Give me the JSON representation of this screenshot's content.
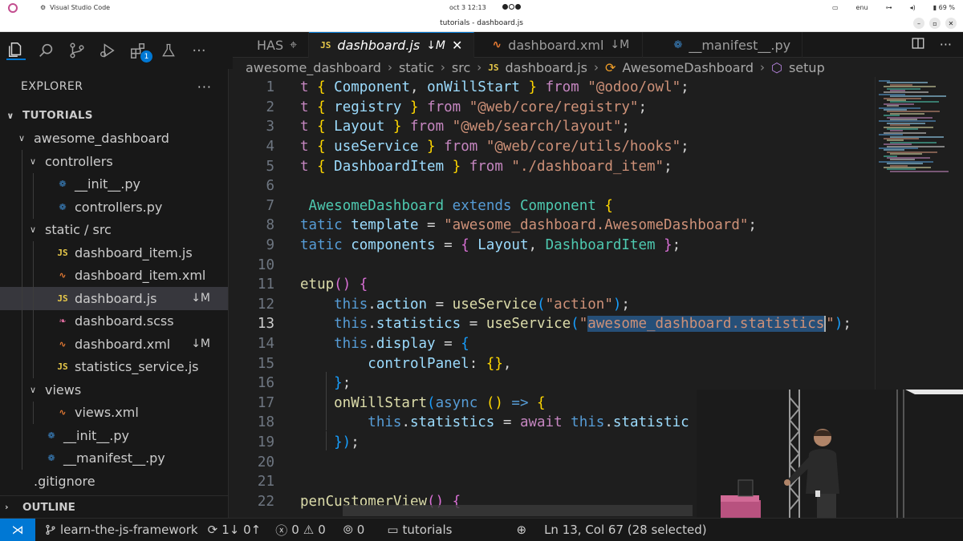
{
  "os_bar": {
    "app_name": "Visual Studio Code",
    "clock": "oct 3  12:13",
    "language": "enu",
    "battery": "69 %"
  },
  "window": {
    "title": "tutorials - dashboard.js"
  },
  "activity_bar": {
    "extensions_badge": "1"
  },
  "sidebar": {
    "header": "EXPLORER",
    "more": "···",
    "root": "TUTORIALS",
    "tree": [
      {
        "label": "awesome_dashboard",
        "type": "folder",
        "depth": 1,
        "expanded": true
      },
      {
        "label": "controllers",
        "type": "folder",
        "depth": 2,
        "expanded": true
      },
      {
        "label": "__init__.py",
        "type": "py",
        "depth": 3
      },
      {
        "label": "controllers.py",
        "type": "py",
        "depth": 3
      },
      {
        "label": "static / src",
        "type": "folder",
        "depth": 2,
        "expanded": true
      },
      {
        "label": "dashboard_item.js",
        "type": "js",
        "depth": 3
      },
      {
        "label": "dashboard_item.xml",
        "type": "xml",
        "depth": 3
      },
      {
        "label": "dashboard.js",
        "type": "js",
        "depth": 3,
        "selected": true,
        "badge": "↓M"
      },
      {
        "label": "dashboard.scss",
        "type": "scss",
        "depth": 3
      },
      {
        "label": "dashboard.xml",
        "type": "xml",
        "depth": 3,
        "badge": "↓M"
      },
      {
        "label": "statistics_service.js",
        "type": "js",
        "depth": 3
      },
      {
        "label": "views",
        "type": "folder",
        "depth": 2,
        "expanded": true
      },
      {
        "label": "views.xml",
        "type": "xml",
        "depth": 3
      },
      {
        "label": "__init__.py",
        "type": "py",
        "depth": 2
      },
      {
        "label": "__manifest__.py",
        "type": "py",
        "depth": 2
      },
      {
        "label": ".gitignore",
        "type": "git",
        "depth": 1
      }
    ],
    "outline": "OUTLINE"
  },
  "tabs": [
    {
      "label": "HAS",
      "icon": "pin-icon",
      "active": false
    },
    {
      "label": "dashboard.js",
      "badge": "↓M",
      "type": "js",
      "active": true
    },
    {
      "label": "dashboard.xml",
      "badge": "↓M",
      "type": "xml",
      "active": false
    },
    {
      "label": "__manifest__.py",
      "type": "py",
      "active": false
    }
  ],
  "breadcrumb": [
    "awesome_dashboard",
    "static",
    "src",
    "dashboard.js",
    "AwesomeDashboard",
    "setup"
  ],
  "editor": {
    "current_line": 13,
    "lines": [
      {
        "n": "1",
        "tokens": [
          [
            "t ",
            "k-kw2"
          ],
          [
            "{ ",
            "k-br1"
          ],
          [
            "Component",
            "k-id"
          ],
          [
            ", ",
            "k-p"
          ],
          [
            "onWillStart",
            "k-id"
          ],
          [
            " } ",
            "k-br1"
          ],
          [
            "from ",
            "k-kw2"
          ],
          [
            "\"@odoo/owl\"",
            "k-str"
          ],
          [
            ";",
            "k-p"
          ]
        ]
      },
      {
        "n": "2",
        "tokens": [
          [
            "t ",
            "k-kw2"
          ],
          [
            "{ ",
            "k-br1"
          ],
          [
            "registry",
            "k-id"
          ],
          [
            " } ",
            "k-br1"
          ],
          [
            "from ",
            "k-kw2"
          ],
          [
            "\"@web/core/registry\"",
            "k-str"
          ],
          [
            ";",
            "k-p"
          ]
        ]
      },
      {
        "n": "3",
        "tokens": [
          [
            "t ",
            "k-kw2"
          ],
          [
            "{ ",
            "k-br1"
          ],
          [
            "Layout",
            "k-id"
          ],
          [
            " } ",
            "k-br1"
          ],
          [
            "from ",
            "k-kw2"
          ],
          [
            "\"@web/search/layout\"",
            "k-str"
          ],
          [
            ";",
            "k-p"
          ]
        ]
      },
      {
        "n": "4",
        "tokens": [
          [
            "t ",
            "k-kw2"
          ],
          [
            "{ ",
            "k-br1"
          ],
          [
            "useService",
            "k-id"
          ],
          [
            " } ",
            "k-br1"
          ],
          [
            "from ",
            "k-kw2"
          ],
          [
            "\"@web/core/utils/hooks\"",
            "k-str"
          ],
          [
            ";",
            "k-p"
          ]
        ]
      },
      {
        "n": "5",
        "tokens": [
          [
            "t ",
            "k-kw2"
          ],
          [
            "{ ",
            "k-br1"
          ],
          [
            "DashboardItem",
            "k-id"
          ],
          [
            " } ",
            "k-br1"
          ],
          [
            "from ",
            "k-kw2"
          ],
          [
            "\"./dashboard_item\"",
            "k-str"
          ],
          [
            ";",
            "k-p"
          ]
        ]
      },
      {
        "n": "6",
        "tokens": []
      },
      {
        "n": "7",
        "tokens": [
          [
            " ",
            "k-p"
          ],
          [
            "AwesomeDashboard ",
            "k-cls"
          ],
          [
            "extends ",
            "k-kw"
          ],
          [
            "Component ",
            "k-cls"
          ],
          [
            "{",
            "k-br1"
          ]
        ]
      },
      {
        "n": "8",
        "tokens": [
          [
            "tatic ",
            "k-kw"
          ],
          [
            "template",
            "k-id"
          ],
          [
            " = ",
            "k-p"
          ],
          [
            "\"awesome_dashboard.AwesomeDashboard\"",
            "k-str"
          ],
          [
            ";",
            "k-p"
          ]
        ]
      },
      {
        "n": "9",
        "tokens": [
          [
            "tatic ",
            "k-kw"
          ],
          [
            "components",
            "k-id"
          ],
          [
            " = ",
            "k-p"
          ],
          [
            "{ ",
            "k-br2"
          ],
          [
            "Layout",
            "k-id"
          ],
          [
            ", ",
            "k-p"
          ],
          [
            "DashboardItem",
            "k-cls"
          ],
          [
            " }",
            "k-br2"
          ],
          [
            ";",
            "k-p"
          ]
        ]
      },
      {
        "n": "10",
        "tokens": []
      },
      {
        "n": "11",
        "tokens": [
          [
            "etup",
            "k-fn"
          ],
          [
            "() ",
            "k-br2"
          ],
          [
            "{",
            "k-br2"
          ]
        ]
      },
      {
        "n": "12",
        "tokens": [
          [
            "    this",
            "k-kw"
          ],
          [
            ".",
            "k-p"
          ],
          [
            "action",
            "k-id"
          ],
          [
            " = ",
            "k-p"
          ],
          [
            "useService",
            "k-fn"
          ],
          [
            "(",
            "k-br3"
          ],
          [
            "\"action\"",
            "k-str"
          ],
          [
            ")",
            "k-br3"
          ],
          [
            ";",
            "k-p"
          ]
        ]
      },
      {
        "n": "13",
        "tokens": [
          [
            "    this",
            "k-kw"
          ],
          [
            ".",
            "k-p"
          ],
          [
            "statistics",
            "k-id"
          ],
          [
            " = ",
            "k-p"
          ],
          [
            "useService",
            "k-fn"
          ],
          [
            "(",
            "k-br3"
          ],
          [
            "\"",
            "k-str"
          ],
          [
            "awesome_dashboard.statistics",
            "k-str sel"
          ],
          [
            "CURSOR",
            ""
          ],
          [
            "\"",
            "k-str"
          ],
          [
            ")",
            "k-br3"
          ],
          [
            ";",
            "k-p"
          ]
        ]
      },
      {
        "n": "14",
        "tokens": [
          [
            "    this",
            "k-kw"
          ],
          [
            ".",
            "k-p"
          ],
          [
            "display",
            "k-id"
          ],
          [
            " = ",
            "k-p"
          ],
          [
            "{",
            "k-br3"
          ]
        ]
      },
      {
        "n": "15",
        "tokens": [
          [
            "        controlPanel",
            "k-id"
          ],
          [
            ": ",
            "k-p"
          ],
          [
            "{}",
            "k-br1"
          ],
          [
            ",",
            "k-p"
          ]
        ]
      },
      {
        "n": "16",
        "tokens": [
          [
            "    }",
            "k-br3"
          ],
          [
            ";",
            "k-p"
          ]
        ]
      },
      {
        "n": "17",
        "tokens": [
          [
            "    onWillStart",
            "k-fn"
          ],
          [
            "(",
            "k-br3"
          ],
          [
            "async ",
            "k-kw"
          ],
          [
            "() ",
            "k-br1"
          ],
          [
            "=> ",
            "k-kw"
          ],
          [
            "{",
            "k-br1"
          ]
        ]
      },
      {
        "n": "18",
        "tokens": [
          [
            "        this",
            "k-kw"
          ],
          [
            ".",
            "k-p"
          ],
          [
            "statistics",
            "k-id"
          ],
          [
            " = ",
            "k-p"
          ],
          [
            "await ",
            "k-kw2"
          ],
          [
            "this",
            "k-kw"
          ],
          [
            ".",
            "k-p"
          ],
          [
            "statistic",
            "k-id"
          ]
        ]
      },
      {
        "n": "19",
        "tokens": [
          [
            "    })",
            "k-br3"
          ],
          [
            ";",
            "k-p"
          ]
        ]
      },
      {
        "n": "20",
        "tokens": []
      },
      {
        "n": "21",
        "tokens": []
      },
      {
        "n": "22",
        "tokens": [
          [
            "penCustomerView",
            "k-fn"
          ],
          [
            "() ",
            "k-br2"
          ],
          [
            "{",
            "k-br2"
          ]
        ]
      }
    ]
  },
  "status_bar": {
    "branch": "learn-the-js-framework",
    "sync": "1↓ 0↑",
    "errors": "0",
    "warnings": "0",
    "ports": "0",
    "folder": "tutorials",
    "position": "Ln 13, Col 67 (28 selected)"
  }
}
